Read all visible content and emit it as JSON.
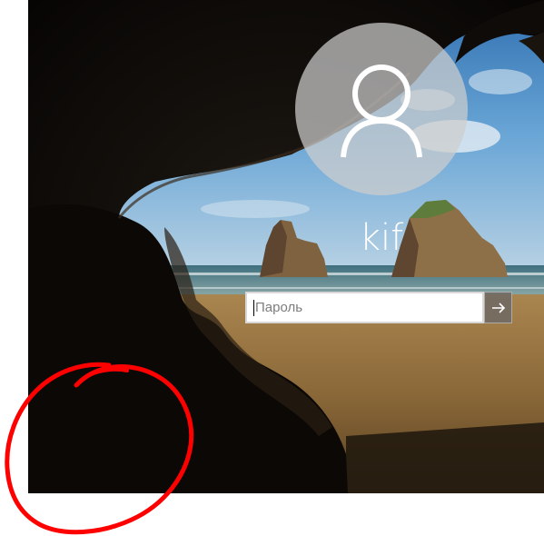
{
  "login": {
    "username": "kif",
    "password_placeholder": "Пароль",
    "password_value": ""
  },
  "icons": {
    "avatar": "user-icon",
    "submit": "arrow-right-icon"
  },
  "colors": {
    "annotation": "#ff0000",
    "input_border": "#d7d7d7"
  }
}
